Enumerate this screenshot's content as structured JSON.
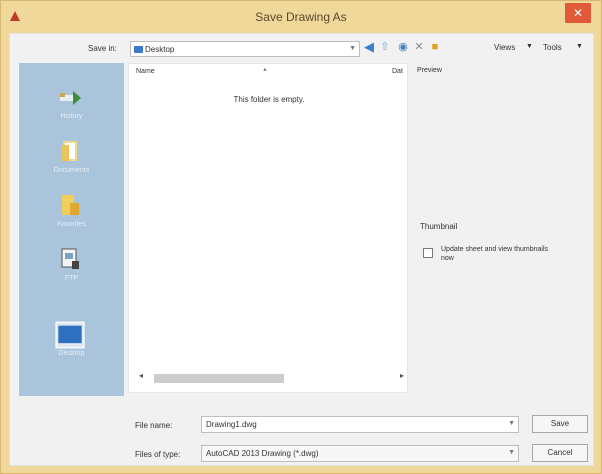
{
  "window": {
    "title": "Save Drawing As",
    "close_glyph": "✕"
  },
  "toolbar": {
    "save_in_label": "Save in:",
    "save_in_value": "Desktop",
    "views_label": "Views",
    "tools_label": "Tools"
  },
  "places": [
    {
      "label": "History",
      "icon": "history-icon"
    },
    {
      "label": "Documents",
      "icon": "documents-folder-icon"
    },
    {
      "label": "Favorites",
      "icon": "favorites-folder-icon"
    },
    {
      "label": "FTP",
      "icon": "ftp-icon"
    },
    {
      "label": "Desktop",
      "icon": "desktop-icon"
    }
  ],
  "filelist": {
    "col_name": "Name",
    "col_date": "Dat",
    "empty_message": "This folder is empty."
  },
  "preview": {
    "title": "Preview",
    "thumbnail_title": "Thumbnail",
    "update_label": "Update sheet and view thumbnails now"
  },
  "bottom": {
    "file_name_label": "File name:",
    "file_name_value": "Drawing1.dwg",
    "file_type_label": "Files of type:",
    "file_type_value": "AutoCAD 2013 Drawing (*.dwg)",
    "save_label": "Save",
    "cancel_label": "Cancel"
  },
  "colors": {
    "title_bar": "#f0d79a",
    "places_bar": "#aac4dc",
    "close_button": "#e05a3a"
  }
}
